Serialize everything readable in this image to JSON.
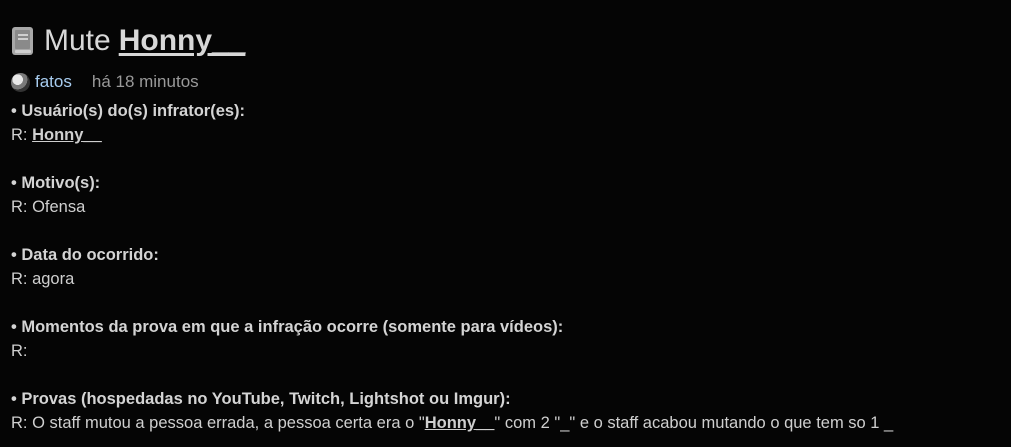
{
  "post": {
    "title_prefix": "Mute",
    "title_user": "Honny__",
    "author": "fatos",
    "time": "há 18 minutos"
  },
  "fields": [
    {
      "question": "• Usuário(s) do(s) infrator(es):",
      "answer_prefix": "R: ",
      "answer_link": "Honny__",
      "answer_mid": "",
      "answer_rest": ""
    },
    {
      "question": "• Motivo(s):",
      "answer_prefix": "R: Ofensa",
      "answer_link": "",
      "answer_mid": "",
      "answer_rest": ""
    },
    {
      "question": "• Data do ocorrido:",
      "answer_prefix": "R: agora",
      "answer_link": "",
      "answer_mid": "",
      "answer_rest": ""
    },
    {
      "question": "• Momentos da prova em que a infração ocorre (somente para vídeos):",
      "answer_prefix": "R:",
      "answer_link": "",
      "answer_mid": "",
      "answer_rest": ""
    },
    {
      "question": "• Provas (hospedadas no YouTube, Twitch, Lightshot ou Imgur):",
      "answer_prefix": "R: O staff mutou a pessoa errada, a pessoa certa era o \"",
      "answer_link": "Honny__",
      "answer_mid": "\" com 2 \"_\" e o staff acabou mutando o que tem so 1 _",
      "answer_rest": ""
    }
  ],
  "colors": {
    "background": "#050505",
    "text": "#d9d9d9",
    "author_link": "#a8cdf0",
    "muted": "#9a9a9a"
  },
  "icons": {
    "title_icon": "book-icon",
    "avatar": "avatar"
  }
}
